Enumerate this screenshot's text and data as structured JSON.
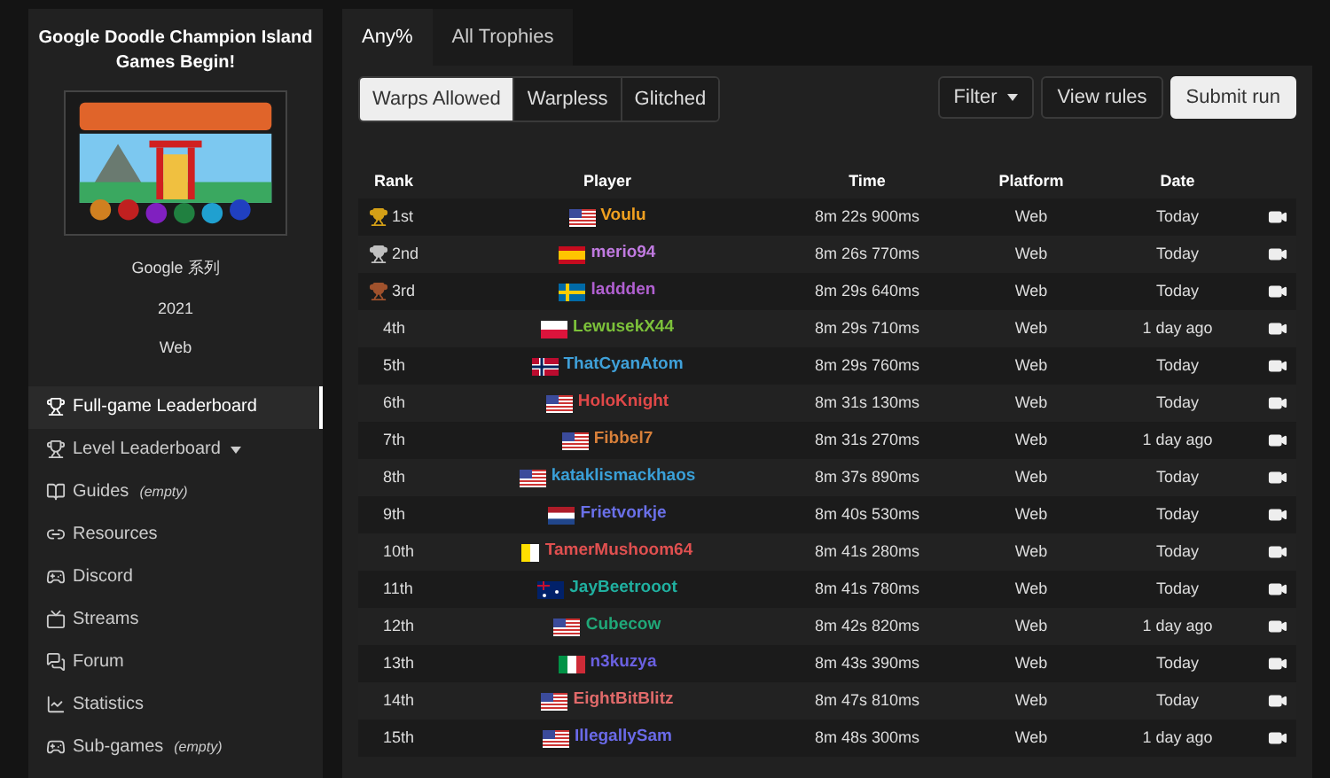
{
  "game": {
    "title": "Google Doodle Champion Island Games Begin!",
    "series": "Google 系列",
    "year": "2021",
    "platform": "Web"
  },
  "nav": [
    {
      "label": "Full-game Leaderboard",
      "kind": "trophy",
      "selected": true
    },
    {
      "label": "Level Leaderboard",
      "kind": "trophy",
      "selected": false,
      "dropdown": true
    },
    {
      "label": "Guides",
      "kind": "book",
      "selected": false,
      "note": "(empty)"
    },
    {
      "label": "Resources",
      "kind": "link",
      "selected": false
    },
    {
      "label": "Discord",
      "kind": "discord",
      "selected": false
    },
    {
      "label": "Streams",
      "kind": "stream",
      "selected": false
    },
    {
      "label": "Forum",
      "kind": "forum",
      "selected": false
    },
    {
      "label": "Statistics",
      "kind": "chart",
      "selected": false
    },
    {
      "label": "Sub-games",
      "kind": "gamepad",
      "selected": false,
      "note": "(empty)"
    }
  ],
  "tabs": [
    {
      "label": "Any%",
      "selected": true
    },
    {
      "label": "All Trophies",
      "selected": false
    }
  ],
  "variants": [
    {
      "label": "Warps Allowed",
      "selected": true
    },
    {
      "label": "Warpless",
      "selected": false
    },
    {
      "label": "Glitched",
      "selected": false
    }
  ],
  "actions": [
    {
      "label": "Filter",
      "kind": "dropdown"
    },
    {
      "label": "View rules",
      "kind": "outline"
    },
    {
      "label": "Submit run",
      "kind": "primary"
    }
  ],
  "table": {
    "columns": [
      "Rank",
      "Player",
      "Time",
      "Platform",
      "Date"
    ],
    "rows": [
      {
        "rank": "1st",
        "kind": "gold",
        "flag": {
          "kind": "us"
        },
        "player": "Voulu",
        "color": "#f0a020",
        "time": "8m 22s 900ms",
        "platform": "Web",
        "date": "Today"
      },
      {
        "rank": "2nd",
        "kind": "silver",
        "flag": {
          "kind": "es"
        },
        "player": "merio94",
        "color": "#c07ae0",
        "time": "8m 26s 770ms",
        "platform": "Web",
        "date": "Today"
      },
      {
        "rank": "3rd",
        "kind": "bronze",
        "flag": {
          "kind": "se"
        },
        "player": "laddden",
        "color": "#b060d0",
        "time": "8m 29s 640ms",
        "platform": "Web",
        "date": "Today"
      },
      {
        "rank": "4th",
        "kind": "plain",
        "flag": {
          "kind": "pl"
        },
        "player": "LewusekX44",
        "color": "#7cc13a",
        "time": "8m 29s 710ms",
        "platform": "Web",
        "date": "1 day ago"
      },
      {
        "rank": "5th",
        "kind": "plain",
        "flag": {
          "kind": "no"
        },
        "player": "ThatCyanAtom",
        "color": "#3fa0d8",
        "time": "8m 29s 760ms",
        "platform": "Web",
        "date": "Today"
      },
      {
        "rank": "6th",
        "kind": "plain",
        "flag": {
          "kind": "us"
        },
        "player": "HoloKnight",
        "color": "#e04848",
        "time": "8m 31s 130ms",
        "platform": "Web",
        "date": "Today"
      },
      {
        "rank": "7th",
        "kind": "plain",
        "flag": {
          "kind": "us"
        },
        "player": "Fibbel7",
        "color": "#d8803a",
        "time": "8m 31s 270ms",
        "platform": "Web",
        "date": "1 day ago"
      },
      {
        "rank": "8th",
        "kind": "plain",
        "flag": {
          "kind": "us"
        },
        "player": "kataklismackhaos",
        "color": "#3aa0d8",
        "time": "8m 37s 890ms",
        "platform": "Web",
        "date": "Today"
      },
      {
        "rank": "9th",
        "kind": "plain",
        "flag": {
          "kind": "nl"
        },
        "player": "Frietvorkje",
        "color": "#6a70e8",
        "time": "8m 40s 530ms",
        "platform": "Web",
        "date": "Today"
      },
      {
        "rank": "10th",
        "kind": "plain",
        "flag": {
          "kind": "va"
        },
        "player": "TamerMushoom64",
        "color": "#e05050",
        "time": "8m 41s 280ms",
        "platform": "Web",
        "date": "Today"
      },
      {
        "rank": "11th",
        "kind": "plain",
        "flag": {
          "kind": "au"
        },
        "player": "JayBeetrooot",
        "color": "#20b0a0",
        "time": "8m 41s 780ms",
        "platform": "Web",
        "date": "Today"
      },
      {
        "rank": "12th",
        "kind": "plain",
        "flag": {
          "kind": "us"
        },
        "player": "Cubecow",
        "color": "#20a878",
        "time": "8m 42s 820ms",
        "platform": "Web",
        "date": "1 day ago"
      },
      {
        "rank": "13th",
        "kind": "plain",
        "flag": {
          "kind": "it"
        },
        "player": "n3kuzya",
        "color": "#6a60e0",
        "time": "8m 43s 390ms",
        "platform": "Web",
        "date": "Today"
      },
      {
        "rank": "14th",
        "kind": "plain",
        "flag": {
          "kind": "us"
        },
        "player": "EightBitBlitz",
        "color": "#e06a6a",
        "time": "8m 47s 810ms",
        "platform": "Web",
        "date": "Today"
      },
      {
        "rank": "15th",
        "kind": "plain",
        "flag": {
          "kind": "us"
        },
        "player": "IllegallySam",
        "color": "#6a6ae8",
        "time": "8m 48s 300ms",
        "platform": "Web",
        "date": "1 day ago"
      }
    ]
  }
}
